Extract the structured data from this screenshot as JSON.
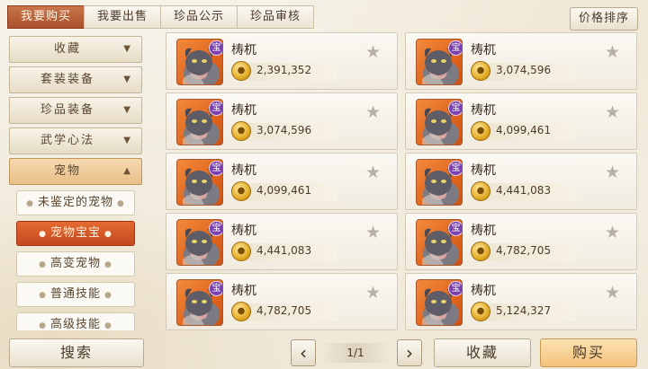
{
  "tabs": [
    {
      "label": "我要购买",
      "active": true
    },
    {
      "label": "我要出售",
      "active": false
    },
    {
      "label": "珍品公示",
      "active": false
    },
    {
      "label": "珍品审核",
      "active": false
    }
  ],
  "sort_label": "价格排序",
  "categories": [
    {
      "label": "收藏",
      "arrow": "▼"
    },
    {
      "label": "套装装备",
      "arrow": "▼"
    },
    {
      "label": "珍品装备",
      "arrow": "▼"
    },
    {
      "label": "武学心法",
      "arrow": "▼"
    },
    {
      "label": "宠物",
      "arrow": "▲"
    }
  ],
  "subcategories": [
    {
      "label": "未鉴定的宠物",
      "active": false
    },
    {
      "label": "宠物宝宝",
      "active": true
    },
    {
      "label": "高变宠物",
      "active": false
    },
    {
      "label": "普通技能",
      "active": false
    },
    {
      "label": "高级技能",
      "active": false
    }
  ],
  "badge_text": "宝",
  "items": [
    {
      "name": "梼杌",
      "price": "2,391,352"
    },
    {
      "name": "梼杌",
      "price": "3,074,596"
    },
    {
      "name": "梼杌",
      "price": "3,074,596"
    },
    {
      "name": "梼杌",
      "price": "4,099,461"
    },
    {
      "name": "梼杌",
      "price": "4,099,461"
    },
    {
      "name": "梼杌",
      "price": "4,441,083"
    },
    {
      "name": "梼杌",
      "price": "4,441,083"
    },
    {
      "name": "梼杌",
      "price": "4,782,705"
    },
    {
      "name": "梼杌",
      "price": "4,782,705"
    },
    {
      "name": "梼杌",
      "price": "5,124,327"
    }
  ],
  "search_label": "搜索",
  "pager": {
    "label": "1/1",
    "prev": "‹",
    "next": "›"
  },
  "favorite_label": "收藏",
  "buy_label": "购买"
}
